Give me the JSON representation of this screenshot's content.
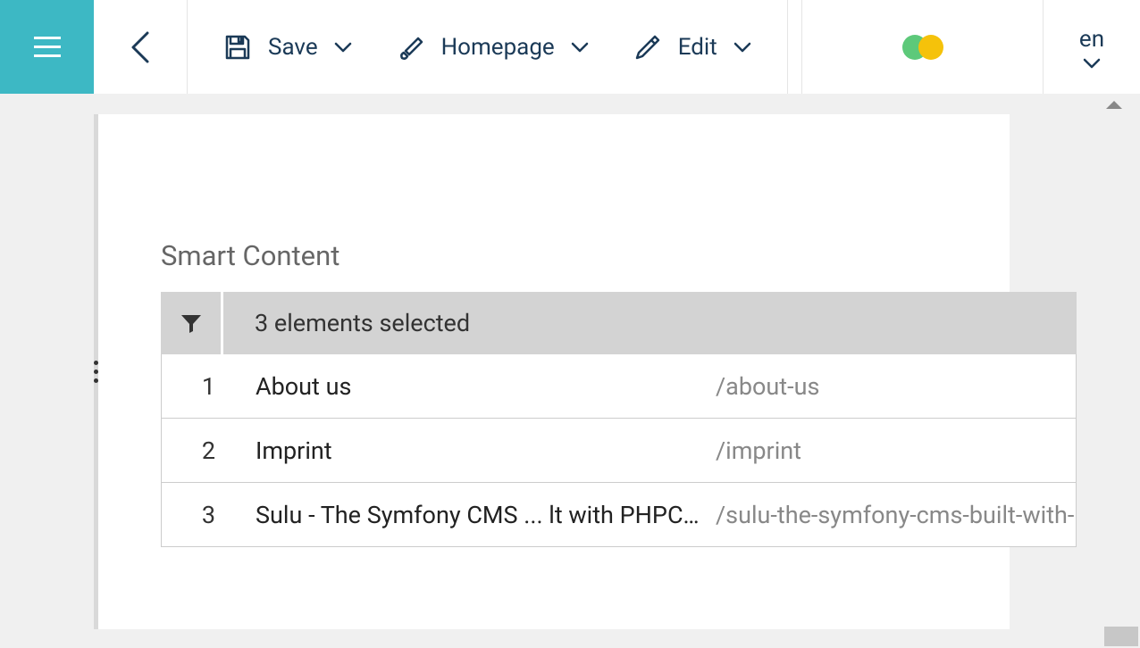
{
  "toolbar": {
    "save_label": "Save",
    "homepage_label": "Homepage",
    "edit_label": "Edit",
    "lang": "en"
  },
  "section": {
    "title": "Smart Content",
    "filter_summary": "3 elements selected"
  },
  "rows": [
    {
      "num": "1",
      "title": "About us",
      "path": "/about-us"
    },
    {
      "num": "2",
      "title": "Imprint",
      "path": "/imprint"
    },
    {
      "num": "3",
      "title": "Sulu - The Symfony CMS ... lt with PHPCR and React",
      "path": "/sulu-the-symfony-cms-built-with-phpcr-a"
    }
  ]
}
